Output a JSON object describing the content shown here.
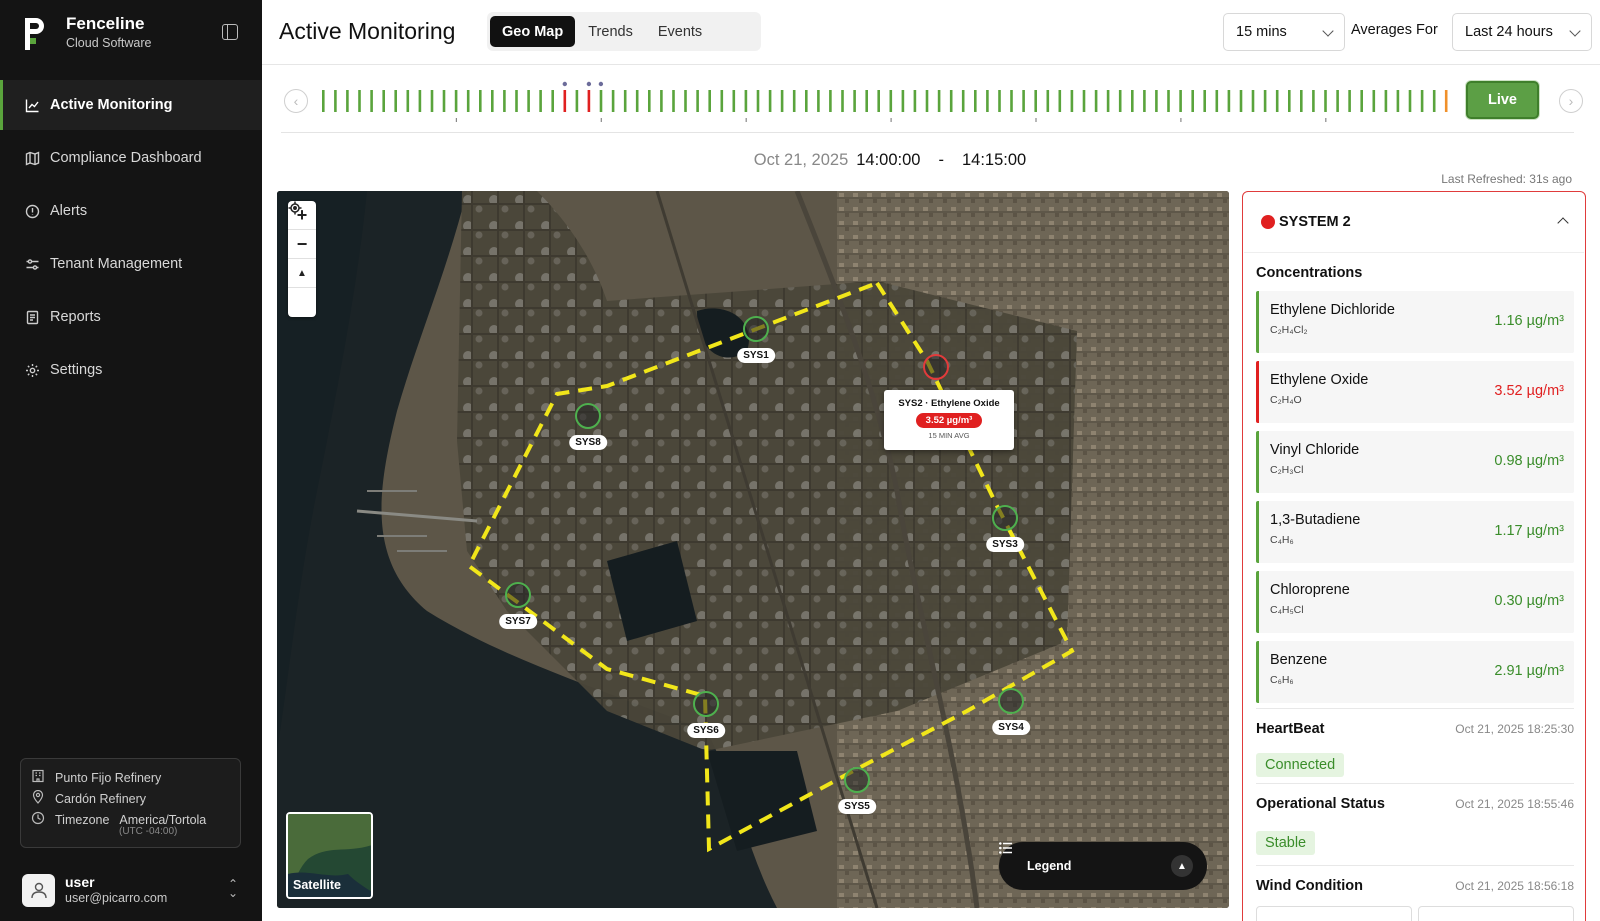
{
  "brand": {
    "title": "Fenceline",
    "subtitle": "Cloud Software"
  },
  "nav": [
    {
      "label": "Active Monitoring",
      "icon": "chart-icon",
      "active": true
    },
    {
      "label": "Compliance Dashboard",
      "icon": "map-book-icon",
      "active": false
    },
    {
      "label": "Alerts",
      "icon": "alert-circle-icon",
      "active": false
    },
    {
      "label": "Tenant Management",
      "icon": "sliders-icon",
      "active": false
    },
    {
      "label": "Reports",
      "icon": "document-icon",
      "active": false
    },
    {
      "label": "Settings",
      "icon": "gear-icon",
      "active": false
    }
  ],
  "site": {
    "refinery": "Punto Fijo Refinery",
    "location": "Cardón Refinery",
    "timezone_label": "Timezone",
    "timezone": "America/Tortola",
    "timezone_offset": "(UTC -04:00)"
  },
  "user": {
    "name": "user",
    "email": "user@picarro.com"
  },
  "header": {
    "title": "Active Monitoring",
    "tabs": [
      "Geo Map",
      "Trends",
      "Events"
    ],
    "active_tab": "Geo Map",
    "interval": "15 mins",
    "averages_label": "Averages For",
    "averages_value": "Last 24 hours"
  },
  "timeline": {
    "live_label": "Live",
    "red_bars": [
      20,
      22
    ],
    "orange_bars": [
      93
    ],
    "bar_count": 94
  },
  "time_range": {
    "date": "Oct 21, 2025",
    "start": "14:00:00",
    "separator": "-",
    "end": "14:15:00"
  },
  "last_refreshed": "Last Refreshed: 31s ago",
  "map": {
    "sensors": [
      "SYS1",
      "SYS2",
      "SYS3",
      "SYS4",
      "SYS5",
      "SYS6",
      "SYS7",
      "SYS8"
    ],
    "alert_sensor": "SYS2",
    "popup": {
      "title": "SYS2 · Ethylene Oxide",
      "value": "3.52 µg/m³",
      "sub": "15 MIN AVG"
    },
    "satellite_label": "Satellite",
    "legend_label": "Legend",
    "zoom_in": "+",
    "zoom_out": "−"
  },
  "panel": {
    "system": "SYSTEM 2",
    "status_color": "#e02020",
    "concentrations_title": "Concentrations",
    "concentrations": [
      {
        "name": "Ethylene Dichloride",
        "formula": "C₂H₄Cl₂",
        "value": "1.16 µg/m³",
        "alert": false
      },
      {
        "name": "Ethylene Oxide",
        "formula": "C₂H₄O",
        "value": "3.52 µg/m³",
        "alert": true
      },
      {
        "name": "Vinyl Chloride",
        "formula": "C₂H₃Cl",
        "value": "0.98 µg/m³",
        "alert": false
      },
      {
        "name": "1,3-Butadiene",
        "formula": "C₄H₆",
        "value": "1.17 µg/m³",
        "alert": false
      },
      {
        "name": "Chloroprene",
        "formula": "C₄H₅Cl",
        "value": "0.30 µg/m³",
        "alert": false
      },
      {
        "name": "Benzene",
        "formula": "C₆H₆",
        "value": "2.91 µg/m³",
        "alert": false
      }
    ],
    "heartbeat": {
      "title": "HeartBeat",
      "time": "Oct 21, 2025 18:25:30",
      "status": "Connected"
    },
    "operational": {
      "title": "Operational Status",
      "time": "Oct 21, 2025 18:55:46",
      "status": "Stable"
    },
    "wind": {
      "title": "Wind Condition",
      "time": "Oct 21, 2025 18:56:18"
    }
  },
  "colors": {
    "accent_green": "#5aa43c",
    "alert_red": "#e02020",
    "warn_orange": "#f0902a"
  }
}
